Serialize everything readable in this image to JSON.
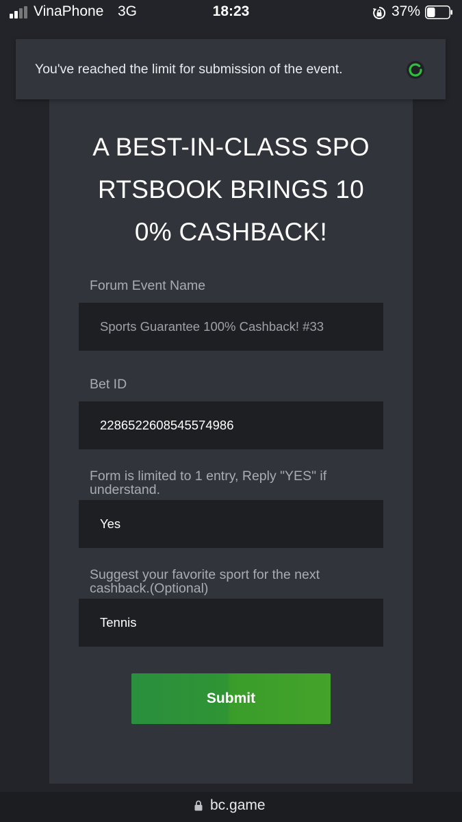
{
  "status_bar": {
    "carrier": "VinaPhone",
    "network": "3G",
    "time": "18:23",
    "battery_percent": "37%",
    "battery_level": 0.37,
    "icons": [
      "signal-icon",
      "rotation-lock-icon",
      "battery-icon"
    ]
  },
  "notification": {
    "message": "You've reached the limit for submission of the event.",
    "icon": "loading-spinner-icon",
    "accent_color": "#2fbf3f"
  },
  "form": {
    "headline_lines": [
      "A BEST-IN-CLASS SPO",
      "RTSBOOK BRINGS 10",
      "0% CASHBACK!"
    ],
    "fields": [
      {
        "label": "Forum Event Name",
        "value": "Sports Guarantee 100% Cashback! #33"
      },
      {
        "label": "Bet ID",
        "value": "2286522608545574986"
      },
      {
        "label_lines": [
          "Form is limited to 1 entry, Reply \"YES\" if",
          "understand."
        ],
        "value": "Yes"
      },
      {
        "label_lines": [
          "Suggest your favorite sport for the next",
          "cashback.(Optional)"
        ],
        "value": "Tennis"
      }
    ],
    "submit_label": "Submit",
    "submit_color": "#2f9a33"
  },
  "address_bar": {
    "url": "bc.game",
    "icon": "lock-icon"
  }
}
